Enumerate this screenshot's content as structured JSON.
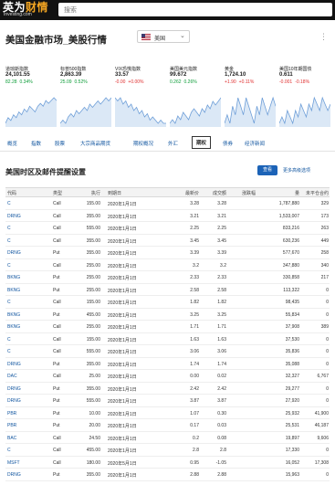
{
  "header": {
    "logo_main": "英为",
    "logo_accent": "财情",
    "logo_sub": "Investing.com",
    "search_placeholder": "搜索"
  },
  "page": {
    "title": "美国金融市场_美股行情",
    "region": "美国",
    "more_icon": "vertical-dots-icon"
  },
  "tickers": [
    {
      "name": "道琼斯指数",
      "value": "24,101.55",
      "change": "82.28",
      "pct": "0.34%",
      "dir": "up",
      "spark": [
        4,
        6,
        5,
        7,
        6,
        8,
        7,
        9,
        8,
        10,
        9,
        8,
        10,
        11,
        10,
        12,
        11,
        12,
        13,
        12
      ]
    },
    {
      "name": "标普500指数",
      "value": "2,863.39",
      "change": "25.09",
      "pct": "0.52%",
      "dir": "up",
      "spark": [
        5,
        6,
        5,
        7,
        8,
        7,
        9,
        8,
        9,
        10,
        9,
        11,
        10,
        11,
        12,
        11,
        12,
        13,
        12,
        13
      ]
    },
    {
      "name": "VIX恐慌指数",
      "value": "33.57",
      "change": "-0.00",
      "pct": "+0.00%",
      "dir": "down",
      "spark": [
        12,
        11,
        12,
        10,
        11,
        9,
        10,
        8,
        9,
        7,
        8,
        6,
        7,
        5,
        6,
        5,
        4,
        5,
        4,
        4
      ]
    },
    {
      "name": "美国美元指数",
      "value": "99.672",
      "change": "0.262",
      "pct": "0.26%",
      "dir": "up",
      "spark": [
        6,
        7,
        6,
        8,
        7,
        9,
        8,
        7,
        9,
        10,
        9,
        8,
        10,
        9,
        11,
        10,
        12,
        11,
        12,
        13
      ]
    },
    {
      "name": "黄金",
      "value": "1,724.10",
      "change": "+1.90",
      "pct": "+0.11%",
      "dir": "down",
      "spark": [
        9,
        10,
        9,
        11,
        10,
        12,
        11,
        10,
        12,
        11,
        10,
        9,
        11,
        10,
        12,
        11,
        10,
        11,
        12,
        11
      ]
    },
    {
      "name": "美国10年期国债",
      "value": "0.611",
      "change": "-0.001",
      "pct": "-0.18%",
      "dir": "down",
      "spark": [
        8,
        9,
        8,
        10,
        9,
        8,
        10,
        9,
        11,
        10,
        9,
        11,
        10,
        12,
        11,
        10,
        12,
        11,
        10,
        11
      ]
    }
  ],
  "tabs": [
    "概览",
    "指数",
    "股票",
    "大宗商品期货",
    "期权概况",
    "外汇",
    "期权",
    "债券",
    "经济新闻"
  ],
  "active_tab": "期权",
  "section": {
    "title": "美国时区及邮件提醒设置",
    "button": "查看",
    "link": "更多高级选项"
  },
  "table": {
    "headers": [
      "代码",
      "类型",
      "执行",
      "到期日",
      "最新价",
      "成交额",
      "涨跌幅",
      "量",
      "未平仓合约"
    ],
    "rows": [
      [
        "C",
        "Call",
        "155.00",
        "2020年1月1日",
        "3.28",
        "3.28",
        "1,787,880",
        "329"
      ],
      [
        "DRNG",
        "Call",
        "355.00",
        "2020年1月1日",
        "3.21",
        "3.21",
        "1,533,007",
        "173"
      ],
      [
        "C",
        "Call",
        "555.00",
        "2020年1月1日",
        "2.25",
        "2.25",
        "833,216",
        "263"
      ],
      [
        "C",
        "Call",
        "355.00",
        "2020年1月1日",
        "3.45",
        "3.45",
        "630,236",
        "449"
      ],
      [
        "DRNG",
        "Put",
        "355.00",
        "2020年1月1日",
        "3.39",
        "3.39",
        "577,670",
        "258"
      ],
      [
        "C",
        "Call",
        "255.00",
        "2020年1月1日",
        "3.2",
        "3.2",
        "347,880",
        "340"
      ],
      [
        "BKNG",
        "Put",
        "255.00",
        "2020年1月1日",
        "2.33",
        "2.33",
        "330,858",
        "217"
      ],
      [
        "BKNG",
        "Put",
        "255.00",
        "2020年1月1日",
        "2.58",
        "2.58",
        "113,322",
        "0"
      ],
      [
        "C",
        "Call",
        "155.00",
        "2020年1月1日",
        "1.82",
        "1.82",
        "98,435",
        "0"
      ],
      [
        "BKNG",
        "Put",
        "455.00",
        "2020年1月1日",
        "3.25",
        "3.25",
        "55,834",
        "0"
      ],
      [
        "BKNG",
        "Call",
        "255.00",
        "2020年1月1日",
        "1.71",
        "1.71",
        "37,908",
        "389"
      ],
      [
        "C",
        "Call",
        "155.00",
        "2020年1月1日",
        "1.63",
        "1.63",
        "37,530",
        "0"
      ],
      [
        "C",
        "Call",
        "555.00",
        "2020年1月1日",
        "3.06",
        "3.06",
        "35,836",
        "0"
      ],
      [
        "DRNG",
        "Put",
        "355.00",
        "2020年1月1日",
        "1.74",
        "1.74",
        "35,088",
        "0"
      ],
      [
        "DAC",
        "Call",
        "25.00",
        "2020年1月1日",
        "0.00",
        "0.02",
        "32,327",
        "6,767"
      ],
      [
        "DRNG",
        "Put",
        "355.00",
        "2020年1月1日",
        "2.42",
        "2.42",
        "29,277",
        "0"
      ],
      [
        "DRNG",
        "Put",
        "555.00",
        "2020年1月1日",
        "3.87",
        "3.87",
        "27,920",
        "0"
      ],
      [
        "PBR",
        "Put",
        "10.00",
        "2020年1月1日",
        "1.07",
        "0.30",
        "25,932",
        "41,900"
      ],
      [
        "PBR",
        "Put",
        "20.00",
        "2020年1月1日",
        "0.17",
        "0.03",
        "25,531",
        "46,187"
      ],
      [
        "BAC",
        "Call",
        "24.50",
        "2020年1月1日",
        "0.2",
        "0.08",
        "19,897",
        "9,606"
      ],
      [
        "C",
        "Call",
        "455.00",
        "2020年1月1日",
        "2.8",
        "2.8",
        "17,330",
        "0"
      ],
      [
        "MSFT",
        "Call",
        "180.00",
        "2020年5月1日",
        "0.95",
        "-1.05",
        "16,052",
        "17,308"
      ],
      [
        "DRNG",
        "Put",
        "355.00",
        "2020年1月1日",
        "2.88",
        "2.88",
        "15,963",
        "0"
      ]
    ]
  },
  "colors": {
    "topbar": "#121212",
    "accent": "#f3a522",
    "link": "#1256a0",
    "up": "#0b9c37",
    "down": "#e03131",
    "button": "#1c63b7"
  }
}
